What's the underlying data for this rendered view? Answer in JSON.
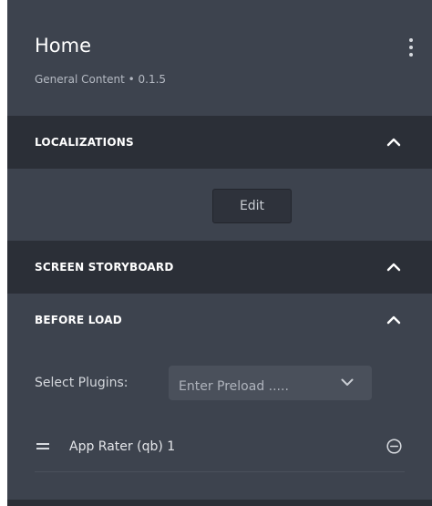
{
  "header": {
    "title": "Home",
    "subtitle": "General Content • 0.1.5",
    "menu_icon": "kebab-vertical-icon"
  },
  "sections": {
    "localizations": {
      "title": "LOCALIZATIONS",
      "expanded": true,
      "edit_label": "Edit"
    },
    "screen_storyboard": {
      "title": "SCREEN STORYBOARD",
      "expanded": true
    },
    "before_load": {
      "title": "BEFORE LOAD",
      "expanded": true,
      "select_label": "Select Plugins:",
      "select_placeholder": "Enter Preload .....",
      "plugins": [
        {
          "name": "App Rater (qb) 1"
        }
      ]
    }
  },
  "icons": {
    "collapse": "chevron-up-icon",
    "dropdown": "chevron-down-icon",
    "drag": "drag-handle-icon",
    "remove": "minus-circle-icon"
  },
  "colors": {
    "panel_bg": "#3d434e",
    "section_header_bg": "#2b2f37",
    "text_primary": "#ffffff",
    "text_muted": "#b4b9c2"
  }
}
